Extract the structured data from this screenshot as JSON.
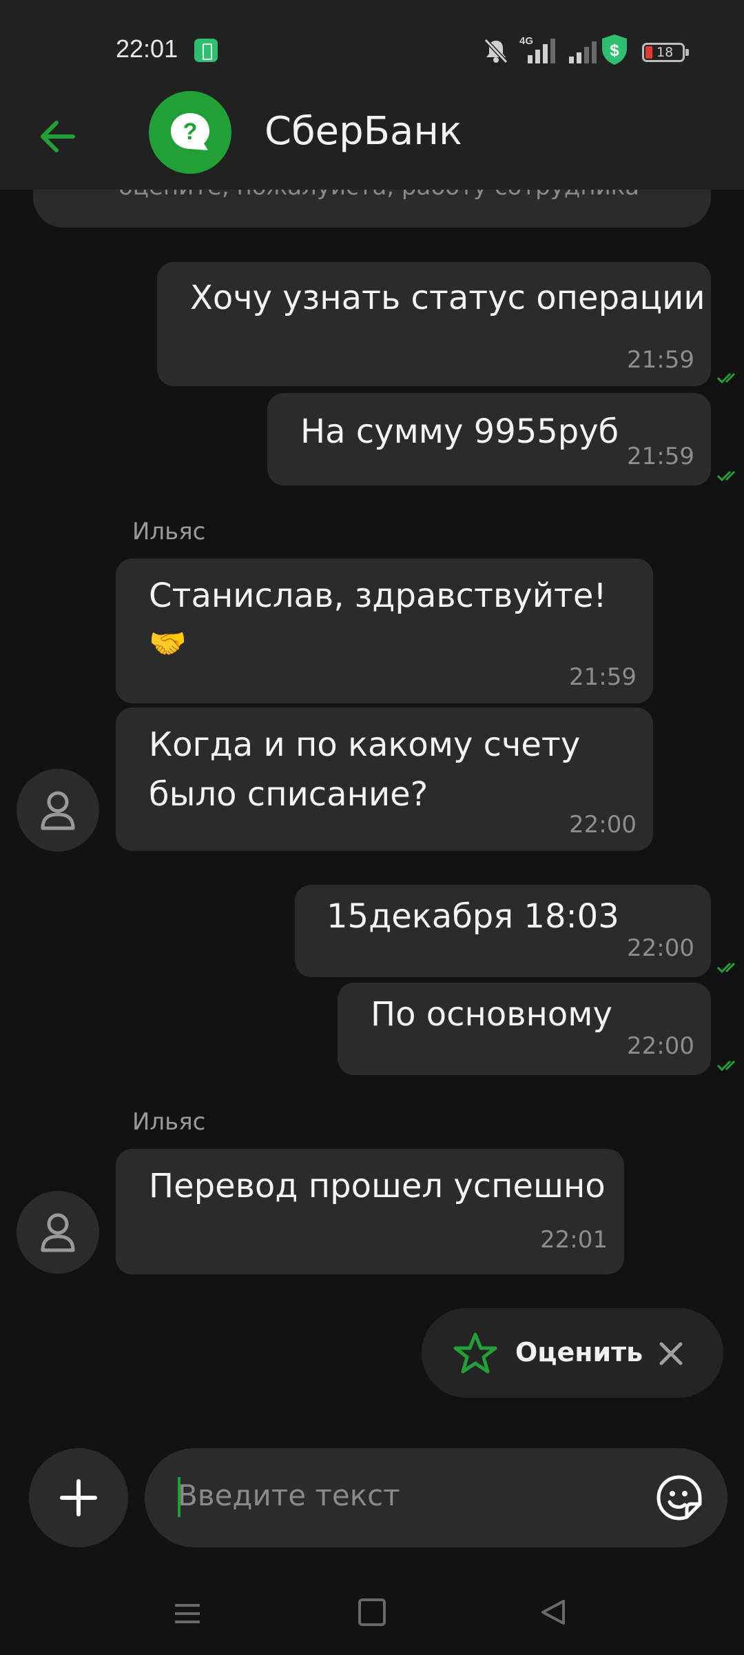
{
  "status_bar": {
    "time": "22:01",
    "network": "4G",
    "battery": "18"
  },
  "header": {
    "title": "СберБанк"
  },
  "previous_message": {
    "text": "оцените, пожалуйста, работу сотрудника"
  },
  "messages": [
    {
      "direction": "out",
      "text": "Хочу узнать статус операции",
      "time": "21:59"
    },
    {
      "direction": "out",
      "text": "На сумму 9955руб",
      "time": "21:59"
    },
    {
      "direction": "in",
      "sender": "Ильяс",
      "text_line1": "Станислав, здравствуйте!",
      "text_line2": "🤝",
      "time": "21:59"
    },
    {
      "direction": "in",
      "text_line1": "Когда и по какому счету",
      "text_line2": "было списание?",
      "time": "22:00"
    },
    {
      "direction": "out",
      "text": "15декабря 18:03",
      "time": "22:00"
    },
    {
      "direction": "out",
      "text": "По основному",
      "time": "22:00"
    },
    {
      "direction": "in",
      "sender": "Ильяс",
      "text": "Перевод прошел успешно",
      "time": "22:01"
    }
  ],
  "rate": {
    "label": "Оценить"
  },
  "composer": {
    "placeholder": "Введите текст"
  },
  "colors": {
    "accent": "#21a038",
    "bubble": "#2b2b2b",
    "background": "#121212"
  },
  "icons": [
    "battery-saver-icon",
    "mute-icon",
    "signal-icon",
    "shield-icon",
    "battery-icon",
    "back-arrow-icon",
    "help-icon",
    "user-icon",
    "star-icon",
    "close-icon",
    "plus-icon",
    "sticker-icon",
    "menu-icon",
    "home-icon",
    "back-icon"
  ]
}
